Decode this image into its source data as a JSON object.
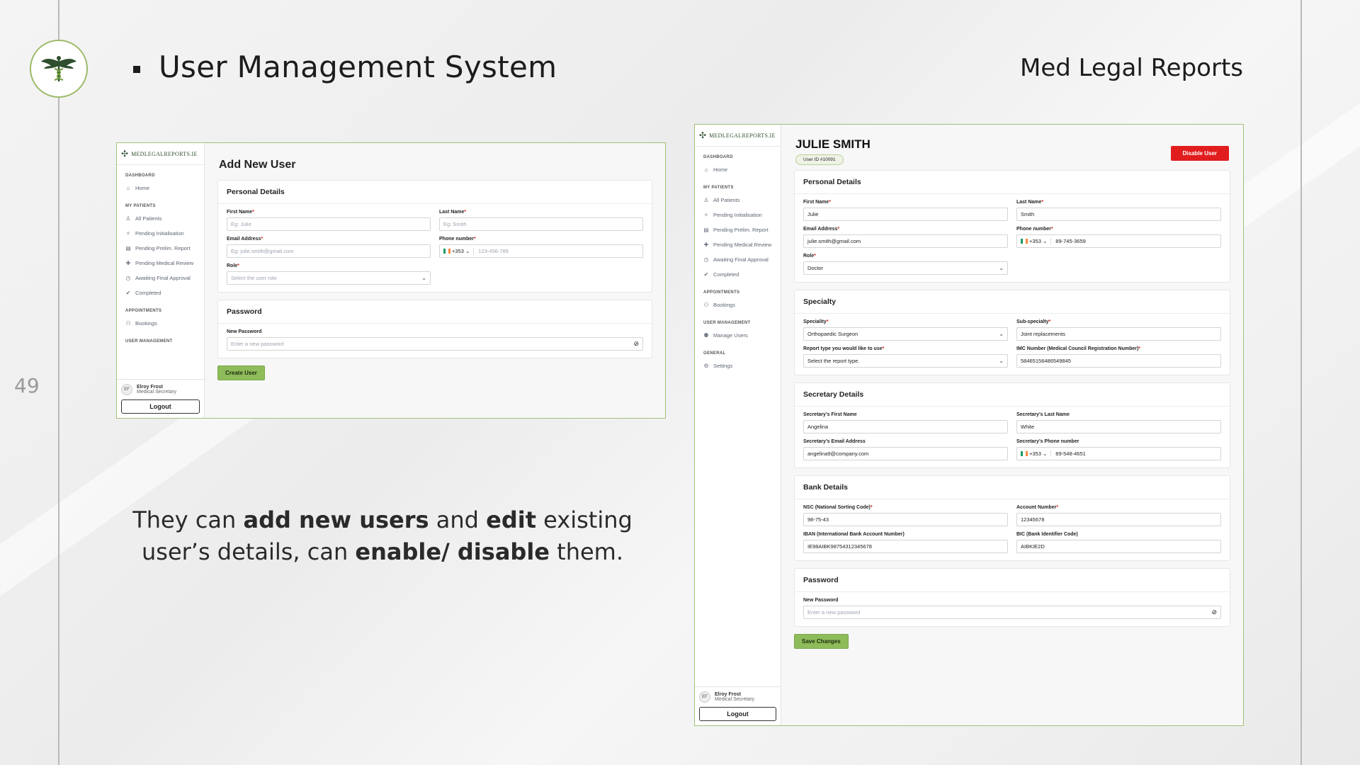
{
  "slide": {
    "title": "User Management System",
    "brand": "Med Legal Reports",
    "page_number": "49",
    "caption_parts": [
      "They can ",
      "add new users",
      " and ",
      "edit",
      " existing user’s details, can ",
      "enable/ disable",
      " them."
    ]
  },
  "app_brand": "MEDLEGALREPORTS.IE",
  "sidebar": {
    "sections": [
      {
        "title": "DASHBOARD",
        "items": [
          {
            "label": "Home",
            "icon": "home-icon"
          }
        ]
      },
      {
        "title": "MY PATIENTS",
        "items": [
          {
            "label": "All Patients",
            "icon": "patients-icon"
          },
          {
            "label": "Pending Initialisation",
            "icon": "wand-icon"
          },
          {
            "label": "Pending Prelim. Report",
            "icon": "document-icon"
          },
          {
            "label": "Pending Medical Review",
            "icon": "medical-cross-icon"
          },
          {
            "label": "Awaiting Final Approval",
            "icon": "clock-icon"
          },
          {
            "label": "Completed",
            "icon": "check-circle-icon"
          }
        ]
      },
      {
        "title": "APPOINTMENTS",
        "items": [
          {
            "label": "Bookings",
            "icon": "bookings-icon"
          }
        ]
      },
      {
        "title": "USER MANAGEMENT",
        "items": [
          {
            "label": "Manage Users",
            "icon": "users-icon"
          }
        ]
      },
      {
        "title": "GENERAL",
        "items": [
          {
            "label": "Settings",
            "icon": "gear-icon"
          }
        ]
      }
    ],
    "user": {
      "initials": "EF",
      "name": "Elroy Frost",
      "role": "Medical Secretary"
    },
    "logout": "Logout"
  },
  "add_user": {
    "heading": "Add New User",
    "personal": {
      "title": "Personal Details",
      "first_name_label": "First Name",
      "first_name_placeholder": "Eg: Julie",
      "last_name_label": "Last Name",
      "last_name_placeholder": "Eg: Smith",
      "email_label": "Email Address",
      "email_placeholder": "Eg: julie.smith@gmail.com",
      "phone_label": "Phone number",
      "phone_code": "+353",
      "phone_placeholder": "123-456-789",
      "role_label": "Role",
      "role_placeholder": "Select the user role"
    },
    "password": {
      "title": "Password",
      "new_label": "New Password",
      "new_placeholder": "Enter a new password"
    },
    "submit": "Create User"
  },
  "edit_user": {
    "name": "JULIE SMITH",
    "user_id": "User ID #10091",
    "disable_button": "Disable User",
    "personal": {
      "title": "Personal Details",
      "first_name_label": "First Name",
      "first_name": "Julie",
      "last_name_label": "Last Name",
      "last_name": "Smith",
      "email_label": "Email Address",
      "email": "julie.smith@gmail.com",
      "phone_label": "Phone number",
      "phone_code": "+353",
      "phone": "89-745-3659",
      "role_label": "Role",
      "role": "Doctor"
    },
    "specialty": {
      "title": "Specialty",
      "speciality_label": "Speciality",
      "speciality": "Orthopaedic Surgeon",
      "sub_label": "Sub-specialty",
      "sub": "Joint replacements",
      "report_label": "Report type you would like to use",
      "report": "Select the report type.",
      "imc_label": "IMC Number (Medical Council Registration Number)",
      "imc": "58465156486549845"
    },
    "secretary": {
      "title": "Secretary Details",
      "first_label": "Secretary’s First Name",
      "first": "Angelina",
      "last_label": "Secretary’s Last Name",
      "last": "White",
      "email_label": "Secretary’s Email Address",
      "email": "angelina9@company.com",
      "phone_label": "Secretary’s Phone number",
      "phone_code": "+353",
      "phone": "89-548-4651"
    },
    "bank": {
      "title": "Bank Details",
      "nsc_label": "NSC (National Sorting Code)",
      "nsc": "98-75-43",
      "account_label": "Account Number",
      "account": "12345678",
      "iban_label": "IBAN (International Bank Account Number)",
      "iban": "IE98AIBK98754312345678",
      "bic_label": "BIC (Bank Identifier Code)",
      "bic": "AIBKIE2D"
    },
    "password": {
      "title": "Password",
      "new_label": "New Password",
      "new_placeholder": "Enter a new password"
    },
    "submit": "Save Changes"
  },
  "colors": {
    "accent_green": "#8fbc5a",
    "danger_red": "#e11d1d",
    "border_green": "#a3c075"
  }
}
